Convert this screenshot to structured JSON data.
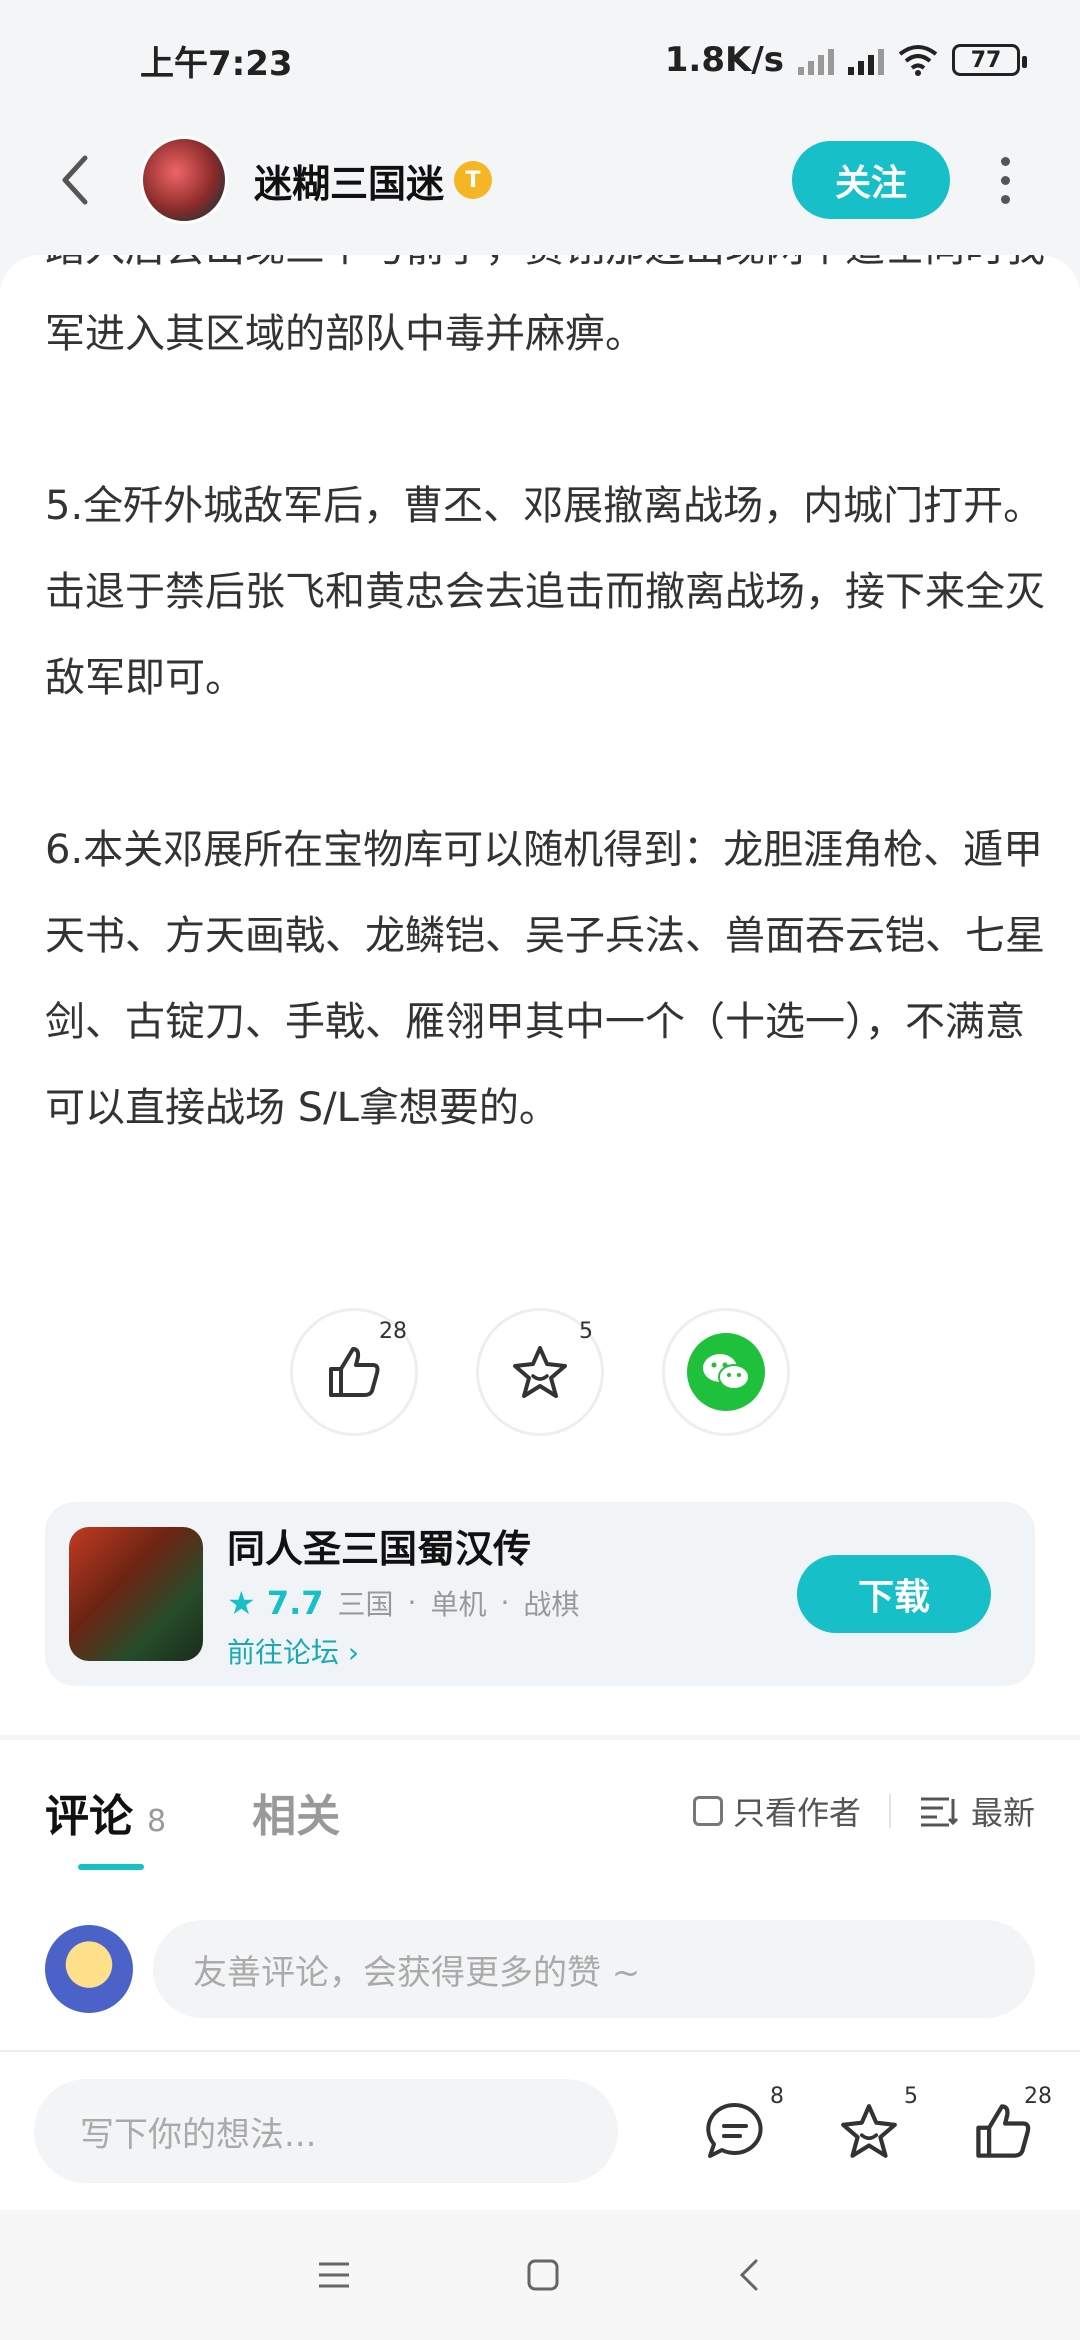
{
  "status_bar": {
    "time": "上午7:23",
    "network_speed": "1.8K/s",
    "battery": "77"
  },
  "header": {
    "author_name": "迷糊三国迷",
    "badge_text": "T",
    "follow_label": "关注"
  },
  "article": {
    "paragraphs": [
      "踏入后会出现三个弓箭手，贾诩那边出现两个道士同时我军进入其区域的部队中毒并麻痹。",
      "5.全歼外城敌军后，曹丕、邓展撤离战场，内城门打开。击退于禁后张飞和黄忠会去追击而撤离战场，接下来全灭敌军即可。",
      "6.本关邓展所在宝物库可以随机得到：龙胆涯角枪、遁甲天书、方天画戟、龙鳞铠、吴子兵法、兽面吞云铠、七星剑、古锭刀、手戟、雁翎甲其中一个（十选一），不满意可以直接战场 S/L拿想要的。"
    ]
  },
  "reactions": {
    "like_count": "28",
    "favorite_count": "5"
  },
  "game_card": {
    "title": "同人圣三国蜀汉传",
    "score": "7.7",
    "tags": [
      "三国",
      "单机",
      "战棋"
    ],
    "forum_link": "前往论坛",
    "download_label": "下载"
  },
  "comments": {
    "tab_comments": "评论",
    "comment_count": "8",
    "tab_related": "相关",
    "author_only": "只看作者",
    "sort_label": "最新",
    "input_placeholder": "友善评论，会获得更多的赞 ~"
  },
  "bottom_bar": {
    "placeholder": "写下你的想法...",
    "comment_count": "8",
    "favorite_count": "5",
    "like_count": "28"
  },
  "colors": {
    "accent": "#17bfc8",
    "wechat": "#1fc13c"
  }
}
